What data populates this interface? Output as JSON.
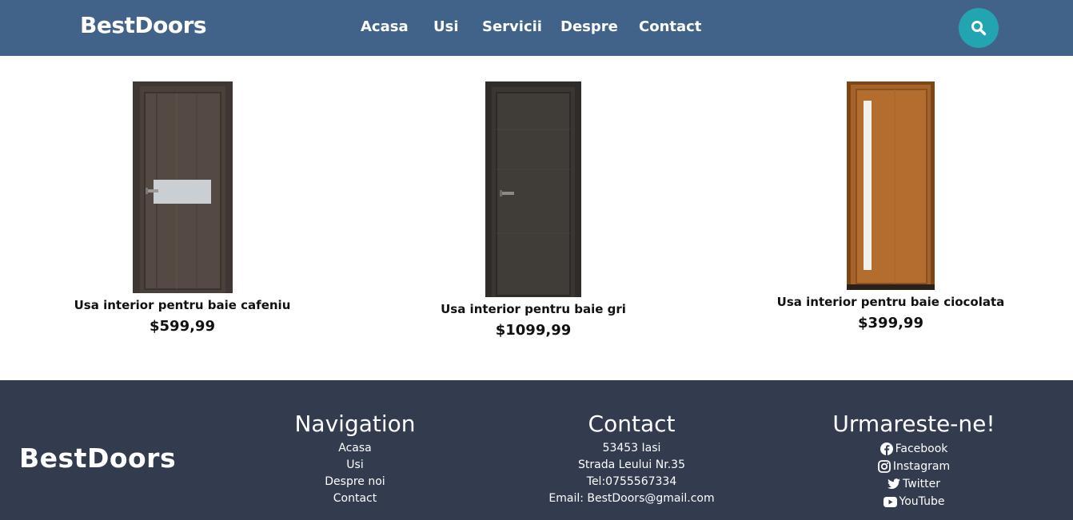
{
  "header": {
    "logo": "BestDoors",
    "nav": [
      "Acasa",
      "Usi",
      "Servicii",
      "Despre",
      "Contact"
    ],
    "search_icon": "search-icon"
  },
  "products": [
    {
      "name": "Usa interior pentru baie cafeniu",
      "price": "$599,99",
      "color": "#4a413b"
    },
    {
      "name": "Usa interior pentru baie gri",
      "price": "$1099,99",
      "color": "#3a3733"
    },
    {
      "name": "Usa interior pentru baie ciocolata",
      "price": "$399,99",
      "color": "#a5622a"
    }
  ],
  "footer": {
    "logo": "BestDoors",
    "navigation": {
      "title": "Navigation",
      "links": [
        "Acasa",
        "Usi",
        "Despre noi",
        "Contact"
      ]
    },
    "contact": {
      "title": "Contact",
      "lines": [
        "53453 Iasi",
        "Strada Leului Nr.35",
        "Tel:0755567334",
        "Email: BestDoors@gmail.com"
      ]
    },
    "social": {
      "title": "Urmareste-ne!",
      "links": [
        {
          "label": "Facebook",
          "icon": "facebook-icon"
        },
        {
          "label": "Instagram",
          "icon": "instagram-icon"
        },
        {
          "label": "Twitter",
          "icon": "twitter-icon"
        },
        {
          "label": "YouTube",
          "icon": "youtube-icon"
        }
      ]
    }
  },
  "colors": {
    "header_bg": "#426389",
    "search_button": "#22a5b1",
    "footer_bg": "#333b4e"
  }
}
